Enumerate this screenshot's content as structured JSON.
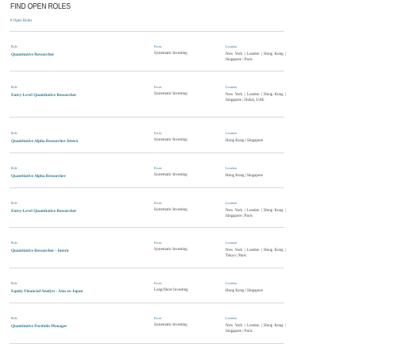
{
  "page": {
    "title": "FIND OPEN ROLES",
    "count_label": "8 Open Roles",
    "column_labels": {
      "role": "Role",
      "focus": "Focus",
      "location": "Location"
    }
  },
  "roles": [
    {
      "role": "Quantitative Researcher",
      "focus": "Systematic Investing",
      "location": "New York  |  London  |  Hong Kong  |  Singapore  |  Paris"
    },
    {
      "role": "Entry-Level Quantitative Researcher",
      "focus": "Systematic Investing",
      "location": "New York  |  London  |  Hong Kong  |  Singapore  |  Dubai, UAE"
    },
    {
      "role": "Quantitative Alpha Researcher Intern",
      "focus": "Systematic Investing",
      "location": "Hong Kong  |  Singapore"
    },
    {
      "role": "Quantitative Alpha Researcher",
      "focus": "Systematic Investing",
      "location": "Hong Kong  |  Singapore"
    },
    {
      "role": "Entry-Level Quantitative Researcher",
      "focus": "Systematic Investing",
      "location": "New York  |  London  |  Hong Kong  |  Singapore  |  Paris"
    },
    {
      "role": "Quantitative Researcher - Intern",
      "focus": "Systematic Investing",
      "location": "New York  |  London  |  Hong Kong  |  Tokyo  |  Paris"
    },
    {
      "role": "Equity Financial Analyst - Asia ex-Japan",
      "focus": "Long/Short Investing",
      "location": "Hong Kong  |  Singapore"
    },
    {
      "role": "Quantitative Portfolio Manager",
      "focus": "Systematic Investing",
      "location": "New York  |  London  |  Hong Kong  |  Singapore  |  Paris"
    }
  ]
}
